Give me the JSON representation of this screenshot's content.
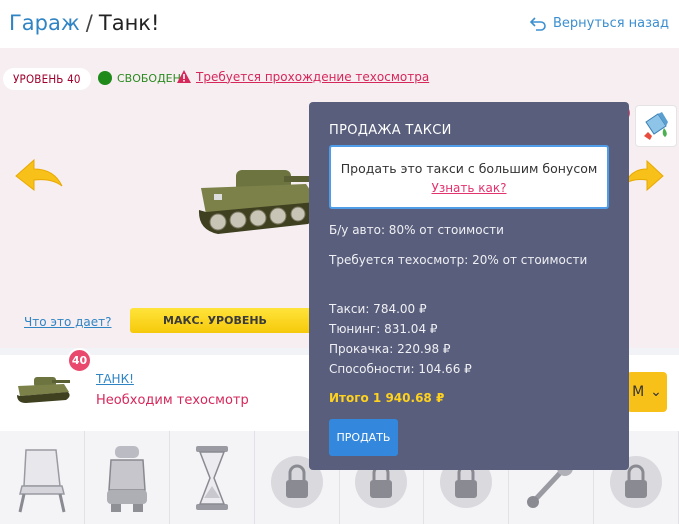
{
  "header": {
    "breadcrumb_garage": "Гараж",
    "separator": "/",
    "breadcrumb_current": "Танк!",
    "back_label": "Вернуться назад",
    "back_icon": "return-arrow-icon"
  },
  "garage": {
    "level_label": "УРОВЕНЬ 40",
    "status_label": "СВОБОДЕН",
    "warning_label": "Требуется прохождение техосмотра",
    "info_link": "Что это дает?",
    "max_level_label": "МАКС. УРОВЕНЬ",
    "bonus_tag": "bonus",
    "bonus_symbol": "$"
  },
  "car_row": {
    "level_badge": "40",
    "name": "ТАНК!",
    "status": "Необходим техосмотр",
    "button_partial": "М",
    "button_chevron": "⌄"
  },
  "sale_popover": {
    "title": "ПРОДАЖА ТАКСИ",
    "bonus_text": "Продать это такси с большим бонусом",
    "bonus_link": "Узнать как?",
    "used_note": "Б/у авто: 80% от стоимости",
    "inspection_note": "Требуется техосмотр: 20% от стоимости",
    "taxi": "Такси: 784.00 ₽",
    "tuning": "Тюнинг: 831.04 ₽",
    "upgrade": "Прокачка: 220.98 ₽",
    "abilities": "Способности: 104.66 ₽",
    "total": "Итого 1 940.68 ₽",
    "sell_button": "ПРОДАТЬ"
  },
  "upgrades": [
    "chair-icon",
    "car-seat-icon",
    "hourglass-icon",
    "locked-upgrade-icon",
    "locked-upgrade-icon",
    "locked-upgrade-icon",
    "pin-icon",
    "locked-upgrade-icon"
  ],
  "colors": {
    "accent_blue": "#2f84c4",
    "warning_pink": "#d6275b",
    "status_green": "#1f8a1a",
    "popover_bg": "#585e7b",
    "total_yellow": "#ffd21f",
    "sell_button": "#3388dd"
  }
}
